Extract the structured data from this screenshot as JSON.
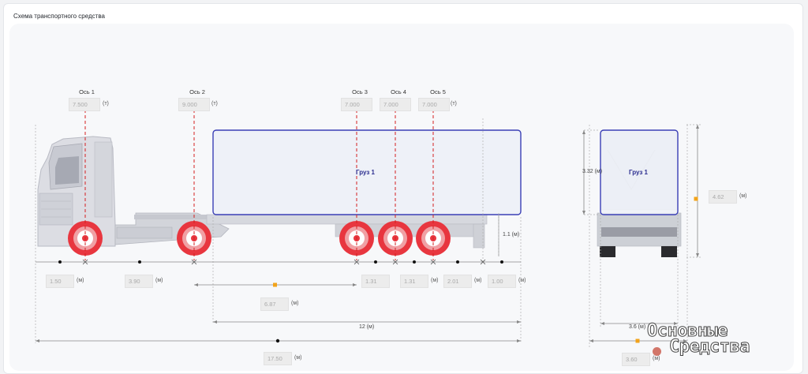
{
  "card_title": "Схема транспортного средства",
  "axles": [
    {
      "label": "Ось 1",
      "load": "7.500",
      "unit": "(т)"
    },
    {
      "label": "Ось 2",
      "load": "9.000",
      "unit": "(т)"
    },
    {
      "label": "Ось 3",
      "load": "7.000",
      "unit": ""
    },
    {
      "label": "Ось 4",
      "load": "7.000",
      "unit": ""
    },
    {
      "label": "Ось 5",
      "load": "7.000",
      "unit": "(т)"
    }
  ],
  "cargo": {
    "side_label": "Груз 1",
    "rear_label": "Груз 1"
  },
  "dimensions": {
    "d1": {
      "value": "1.50",
      "unit": "(м)"
    },
    "d2": {
      "value": "3.90",
      "unit": "(м)"
    },
    "d3": {
      "value": "1.31",
      "unit": ""
    },
    "d4": {
      "value": "1.31",
      "unit": "(м)"
    },
    "d5": {
      "value": "2.01",
      "unit": "(м)"
    },
    "d6": {
      "value": "1.00",
      "unit": "(м)"
    },
    "kingpin_to_axle3": {
      "value": "6.87",
      "unit": "(м)"
    },
    "cargo_length_text": "12 (м)",
    "total_length": {
      "value": "17.50",
      "unit": "(м)"
    },
    "floor_height_text": "1.1 (м)",
    "cargo_height_text": "3.32 (м)",
    "total_height": {
      "value": "4.62",
      "unit": "(м)"
    },
    "cargo_width_text": "3.6 (м)",
    "total_width": {
      "value": "3.60",
      "unit": "(м)"
    }
  },
  "watermark": {
    "line1": "Основные",
    "line2": "Средства"
  },
  "colors": {
    "wheel": "#e8363f",
    "axle_line": "#d42020",
    "cargo_border": "#3a3fb5",
    "cargo_fill": "#eef1f8",
    "marker_orange": "#f2a31b"
  }
}
